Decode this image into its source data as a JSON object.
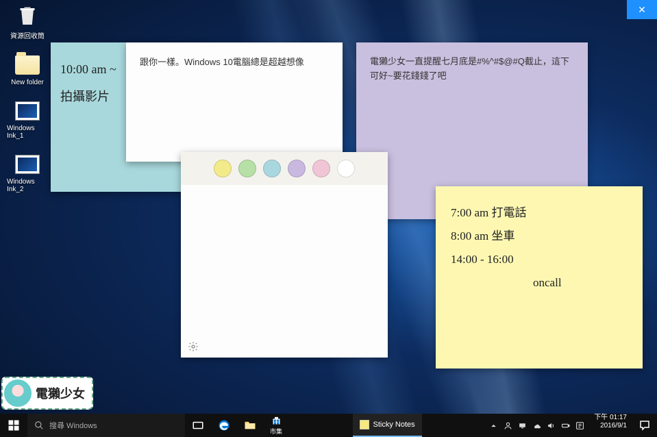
{
  "desktop_icons": {
    "recycle_bin": "資源回收筒",
    "new_folder": "New folder",
    "ink1": "Windows Ink_1",
    "ink2": "Windows Ink_2"
  },
  "close_button_glyph": "✕",
  "notes": {
    "blue": {
      "line1": "10:00 am ~",
      "line2": "拍攝影片"
    },
    "white": "跟你一樣。Windows 10電腦總是超越想像",
    "purple": "電獺少女一直提醒七月底是#%^#$@#Q截止，這下可好~要花錢錢了吧",
    "yellow": {
      "line1": "7:00 am  打電話",
      "line2": "8:00 am  坐車",
      "line3": "14:00 - 16:00",
      "line4": "oncall"
    }
  },
  "color_picker": {
    "colors": [
      "#f3eb8a",
      "#b7e0a6",
      "#a9d7e0",
      "#c9b8e0",
      "#f0c6d6",
      "#ffffff"
    ]
  },
  "watermark": "電獺少女",
  "taskbar": {
    "search_placeholder": "搜尋 Windows",
    "store_label": "市集",
    "running_app": "Sticky Notes",
    "clock_time": "下午 01:17",
    "clock_date": "2016/9/1"
  }
}
